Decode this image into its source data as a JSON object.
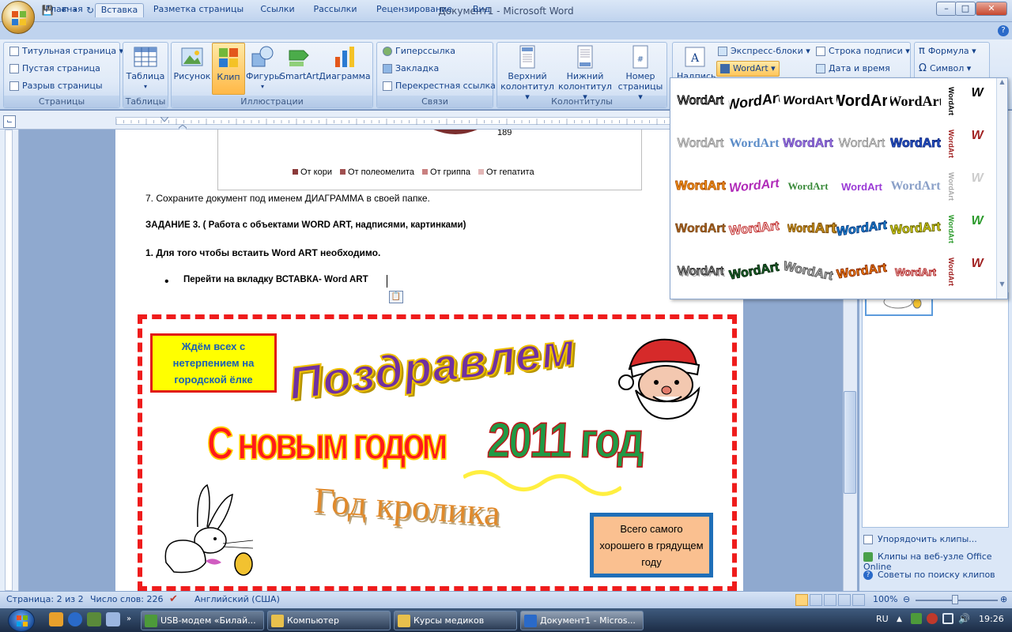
{
  "window": {
    "title": "Документ1 - Microsoft Word"
  },
  "tabs": [
    "Главная",
    "Вставка",
    "Разметка страницы",
    "Ссылки",
    "Рассылки",
    "Рецензирование",
    "Вид"
  ],
  "ribbon": {
    "pages": {
      "label": "Страницы",
      "items": [
        "Титульная страница",
        "Пустая страница",
        "Разрыв страницы"
      ]
    },
    "tables": {
      "label": "Таблицы",
      "table": "Таблица"
    },
    "illustrations": {
      "label": "Иллюстрации",
      "items": [
        "Рисунок",
        "Клип",
        "Фигуры",
        "SmartArt",
        "Диаграмма"
      ]
    },
    "links": {
      "label": "Связи",
      "items": [
        "Гиперссылка",
        "Закладка",
        "Перекрестная ссылка"
      ]
    },
    "headers": {
      "label": "Колонтитулы",
      "items": [
        [
          "Верхний",
          "колонтитул"
        ],
        [
          "Нижний",
          "колонтитул"
        ],
        [
          "Номер",
          "страницы"
        ]
      ]
    },
    "text": {
      "express": "Экспресс-блоки",
      "sigline": "Строка подписи",
      "wordart": "WordArt",
      "datetime": "Дата и время",
      "big": "Надпись"
    },
    "symbols": {
      "formula": "Формула",
      "symbol": "Символ"
    }
  },
  "doc": {
    "chart_value": "189",
    "legend": [
      "От кори",
      "От полеомелита",
      "От гриппа",
      "От гепатита"
    ],
    "legend_colors": [
      "#8b3a3a",
      "#a05050",
      "#c98080",
      "#e2b6b6"
    ],
    "line7": "7. Сохраните документ под именем ДИАГРАММА в своей папке.",
    "task3": "ЗАДАНИЕ 3. ( Работа с объектами WORD ART, надписями, картинками)",
    "step1": "1. Для того чтобы встаить Word ART необходимо.",
    "bullet": "Перейти на вкладку ВСТАВКА- Word ART",
    "box_left": "Ждём всех с нетерпением на городской ёлке",
    "wa_main": "Поздравлем",
    "wa_new": "С новым годом",
    "wa_year": "2011 год",
    "wa_rabbit": "Год кролика",
    "box_right": "Всего самого хорошего в грядущем году"
  },
  "gallery": {
    "sample": "WordArt"
  },
  "clippane": {
    "organize": "Упорядочить клипы...",
    "online": "Клипы на веб-узле Office Online",
    "tips": "Советы по поиску клипов"
  },
  "status": {
    "page": "Страница: 2 из 2",
    "words": "Число слов: 226",
    "lang": "Английский (США)",
    "zoom": "100%"
  },
  "taskbar": {
    "items": [
      "USB-модем «Билай...",
      "Компьютер",
      "Курсы медиков",
      "Документ1 - Micros..."
    ],
    "lang": "RU",
    "time": "19:26"
  }
}
